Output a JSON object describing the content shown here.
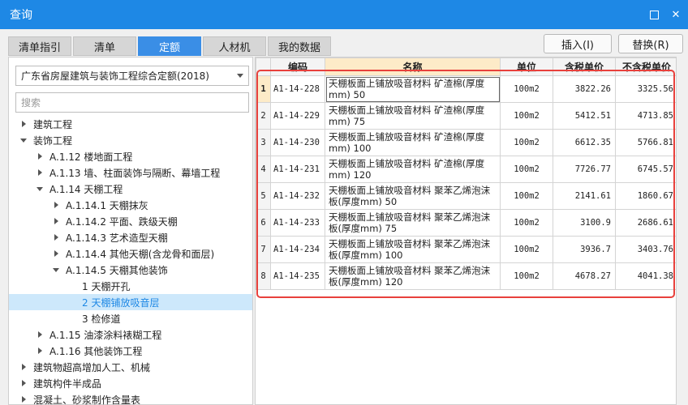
{
  "window": {
    "title": "查询"
  },
  "tabs": [
    {
      "label": "清单指引"
    },
    {
      "label": "清单"
    },
    {
      "label": "定额"
    },
    {
      "label": "人材机"
    },
    {
      "label": "我的数据"
    }
  ],
  "actions": {
    "insert": "插入(I)",
    "replace": "替换(R)"
  },
  "left": {
    "quota_book": "广东省房屋建筑与装饰工程综合定额(2018)",
    "search_placeholder": "搜索",
    "tree": [
      {
        "label": "建筑工程",
        "level": 0,
        "state": "collapsed"
      },
      {
        "label": "装饰工程",
        "level": 0,
        "state": "expanded"
      },
      {
        "label": "A.1.12 楼地面工程",
        "level": 1,
        "state": "collapsed"
      },
      {
        "label": "A.1.13 墙、柱面装饰与隔断、幕墙工程",
        "level": 1,
        "state": "collapsed"
      },
      {
        "label": "A.1.14 天棚工程",
        "level": 1,
        "state": "expanded"
      },
      {
        "label": "A.1.14.1 天棚抹灰",
        "level": 2,
        "state": "collapsed"
      },
      {
        "label": "A.1.14.2 平面、跌级天棚",
        "level": 2,
        "state": "collapsed"
      },
      {
        "label": "A.1.14.3 艺术造型天棚",
        "level": 2,
        "state": "collapsed"
      },
      {
        "label": "A.1.14.4 其他天棚(含龙骨和面层)",
        "level": 2,
        "state": "collapsed"
      },
      {
        "label": "A.1.14.5 天棚其他装饰",
        "level": 2,
        "state": "expanded"
      },
      {
        "label": "1 天棚开孔",
        "level": 3,
        "state": "leaf"
      },
      {
        "label": "2 天棚铺放吸音层",
        "level": 3,
        "state": "leaf",
        "selected": true
      },
      {
        "label": "3 检修道",
        "level": 3,
        "state": "leaf"
      },
      {
        "label": "A.1.15 油漆涂料裱糊工程",
        "level": 1,
        "state": "collapsed"
      },
      {
        "label": "A.1.16 其他装饰工程",
        "level": 1,
        "state": "collapsed"
      },
      {
        "label": "建筑物超高增加人工、机械",
        "level": 0,
        "state": "collapsed"
      },
      {
        "label": "建筑构件半成品",
        "level": 0,
        "state": "collapsed"
      },
      {
        "label": "混凝土、砂浆制作含量表",
        "level": 0,
        "state": "collapsed"
      }
    ]
  },
  "table": {
    "headers": [
      "",
      "编码",
      "名称",
      "单位",
      "含税单价",
      "不含税单价"
    ],
    "rows": [
      {
        "idx": "1",
        "code": "A1-14-228",
        "name": "天棚板面上铺放吸音材料 矿渣棉(厚度mm) 50",
        "unit": "100m2",
        "tax_price": "3822.26",
        "notax_price": "3325.56"
      },
      {
        "idx": "2",
        "code": "A1-14-229",
        "name": "天棚板面上铺放吸音材料 矿渣棉(厚度mm) 75",
        "unit": "100m2",
        "tax_price": "5412.51",
        "notax_price": "4713.85"
      },
      {
        "idx": "3",
        "code": "A1-14-230",
        "name": "天棚板面上铺放吸音材料 矿渣棉(厚度mm) 100",
        "unit": "100m2",
        "tax_price": "6612.35",
        "notax_price": "5766.81"
      },
      {
        "idx": "4",
        "code": "A1-14-231",
        "name": "天棚板面上铺放吸音材料 矿渣棉(厚度mm) 120",
        "unit": "100m2",
        "tax_price": "7726.77",
        "notax_price": "6745.57"
      },
      {
        "idx": "5",
        "code": "A1-14-232",
        "name": "天棚板面上铺放吸音材料 聚苯乙烯泡沫板(厚度mm) 50",
        "unit": "100m2",
        "tax_price": "2141.61",
        "notax_price": "1860.67"
      },
      {
        "idx": "6",
        "code": "A1-14-233",
        "name": "天棚板面上铺放吸音材料 聚苯乙烯泡沫板(厚度mm) 75",
        "unit": "100m2",
        "tax_price": "3100.9",
        "notax_price": "2686.61"
      },
      {
        "idx": "7",
        "code": "A1-14-234",
        "name": "天棚板面上铺放吸音材料 聚苯乙烯泡沫板(厚度mm) 100",
        "unit": "100m2",
        "tax_price": "3936.7",
        "notax_price": "3403.76"
      },
      {
        "idx": "8",
        "code": "A1-14-235",
        "name": "天棚板面上铺放吸音材料 聚苯乙烯泡沫板(厚度mm) 120",
        "unit": "100m2",
        "tax_price": "4678.27",
        "notax_price": "4041.38"
      }
    ]
  },
  "colors": {
    "titlebar": "#1e88e5",
    "active_tab": "#3a8ee6",
    "highlight": "#e8413c",
    "selected_row": "#cde8fb"
  }
}
